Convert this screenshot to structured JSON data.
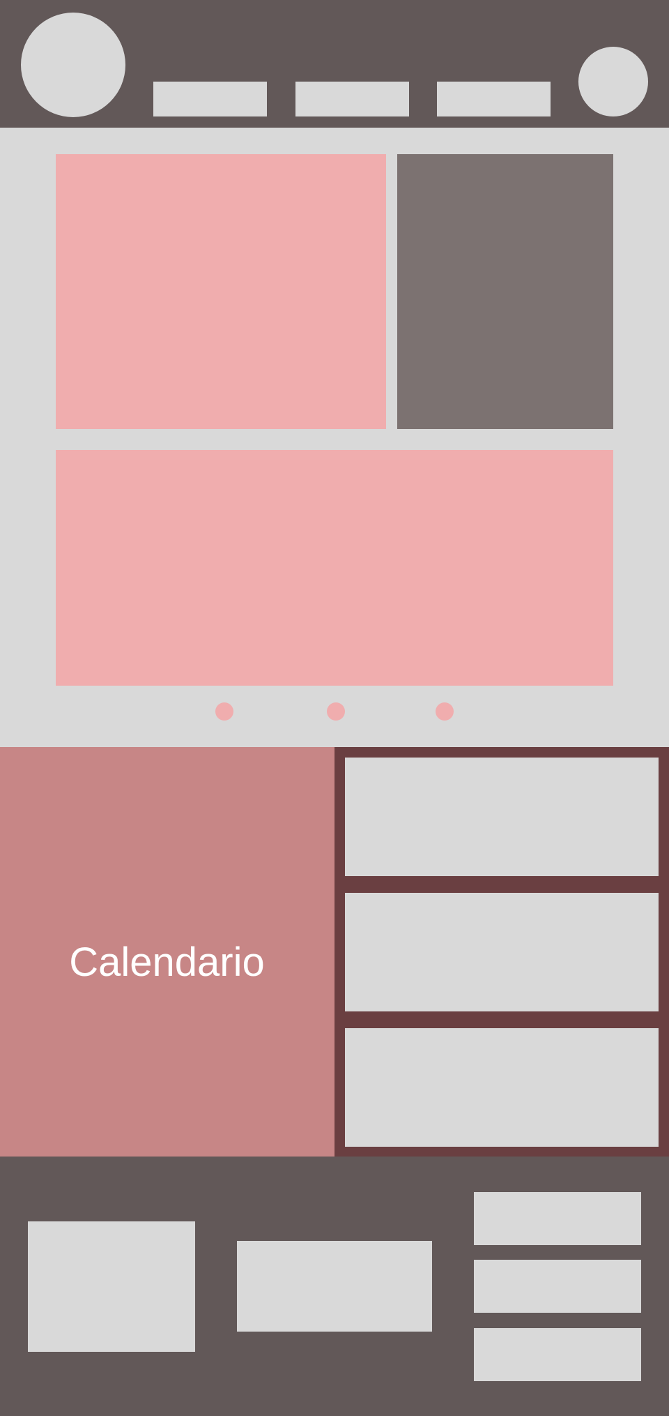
{
  "calendar": {
    "label": "Calendario"
  },
  "colors": {
    "header_bg": "#625858",
    "page_bg": "#d9d9d9",
    "placeholder": "#d9d9d9",
    "accent_pink": "#f0adae",
    "gallery_side": "#7c7271",
    "calendar_bg": "#c78686",
    "events_bg": "#6a3f41",
    "calendar_text": "#ffffff"
  }
}
